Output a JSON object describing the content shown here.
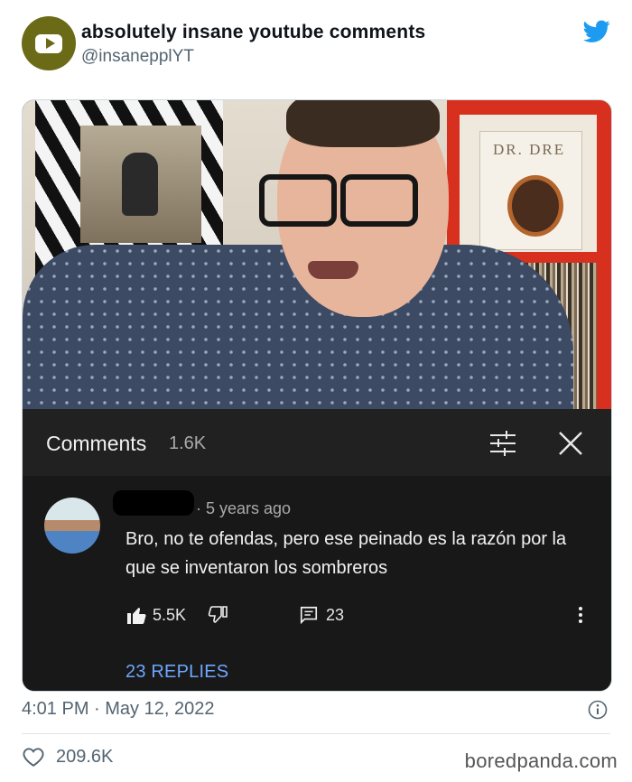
{
  "tweet": {
    "display_name": "absolutely insane youtube comments",
    "handle": "@insanepplYT",
    "timestamp": "4:01 PM · May 12, 2022",
    "likes": "209.6K",
    "brand_color": "#1d9bf0"
  },
  "video": {
    "album_title": "DR. DRE"
  },
  "comments_panel": {
    "title": "Comments",
    "count": "1.6K",
    "comment": {
      "time": "· 5 years ago",
      "text": "Bro, no te ofendas, pero ese peinado es la razón por la que se inventaron los sombreros",
      "likes": "5.5K",
      "reply_count": "23",
      "replies_label": "23 REPLIES"
    }
  },
  "watermark": "boredpanda.com"
}
